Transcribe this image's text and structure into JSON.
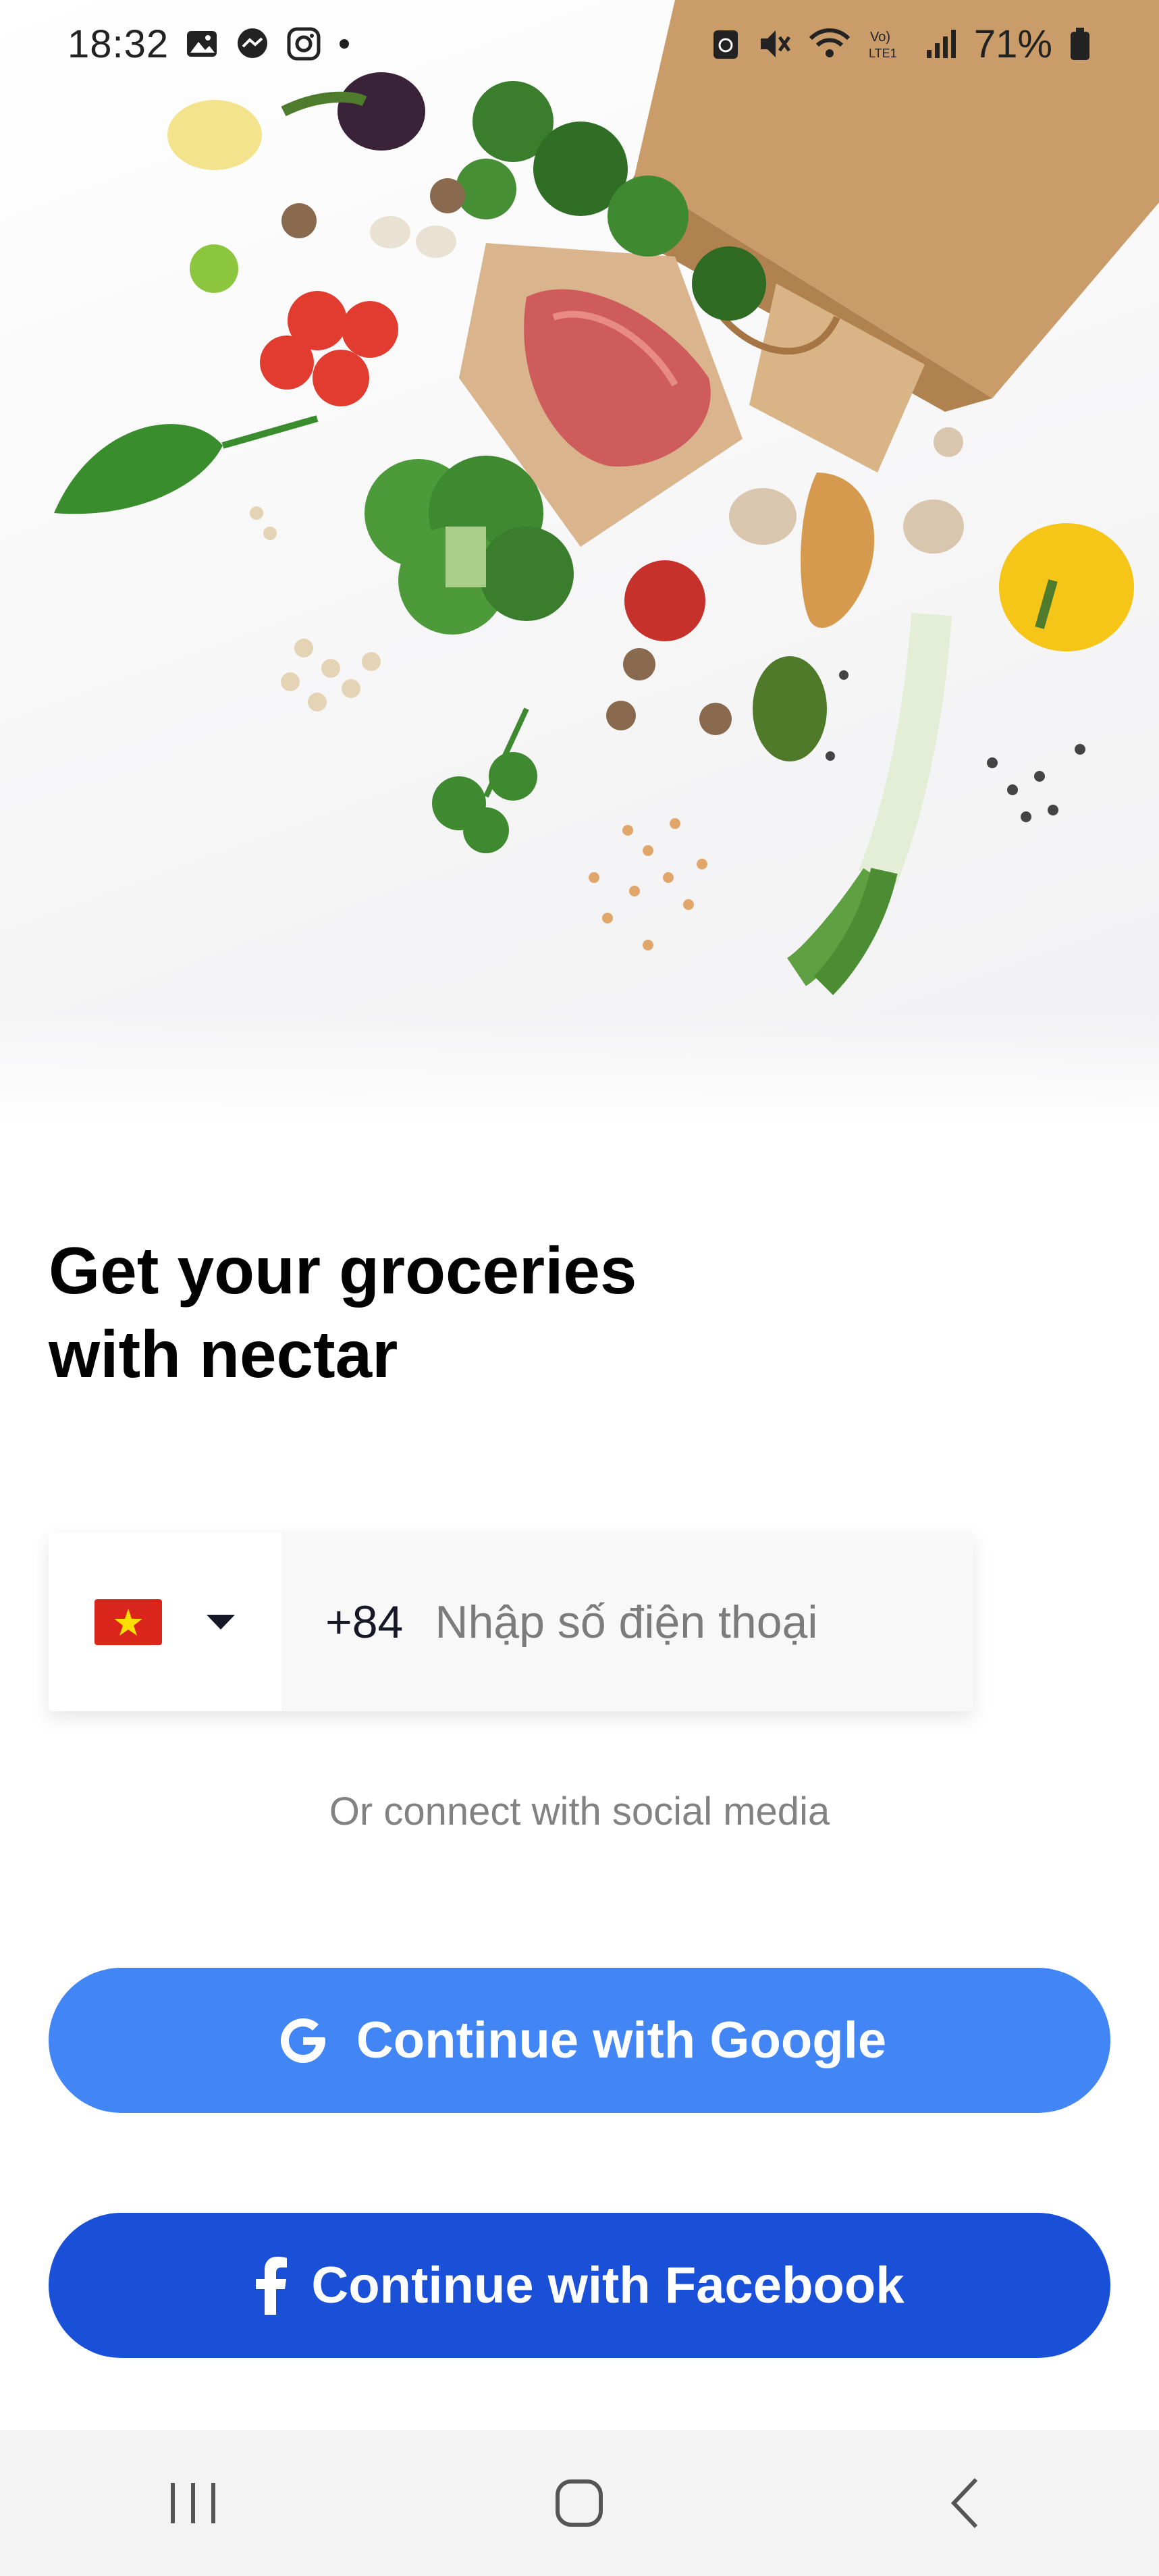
{
  "status_bar": {
    "time": "18:32",
    "battery": "71%",
    "left_icons": [
      "gallery-icon",
      "messenger-icon",
      "instagram-icon",
      "dot-icon"
    ],
    "right_icons": [
      "battery-saver-icon",
      "mute-icon",
      "wifi-icon",
      "volte-icon",
      "signal-icon",
      "battery-icon"
    ]
  },
  "headline": {
    "line1": "Get your groceries",
    "line2": "with nectar"
  },
  "phone": {
    "country_flag": "vietnam-flag-icon",
    "dial_code": "+84",
    "placeholder": "Nhập số điện thoại",
    "value": ""
  },
  "social_caption": "Or connect with social media",
  "buttons": {
    "google_label": "Continue with Google",
    "facebook_label": "Continue with Facebook"
  },
  "nav": {
    "icons": [
      "recent-apps-icon",
      "home-icon",
      "back-icon"
    ]
  },
  "colors": {
    "google_button": "#4285f4",
    "facebook_button": "#1a4fd8",
    "flag_red": "#da251d",
    "flag_star": "#ffde00"
  }
}
